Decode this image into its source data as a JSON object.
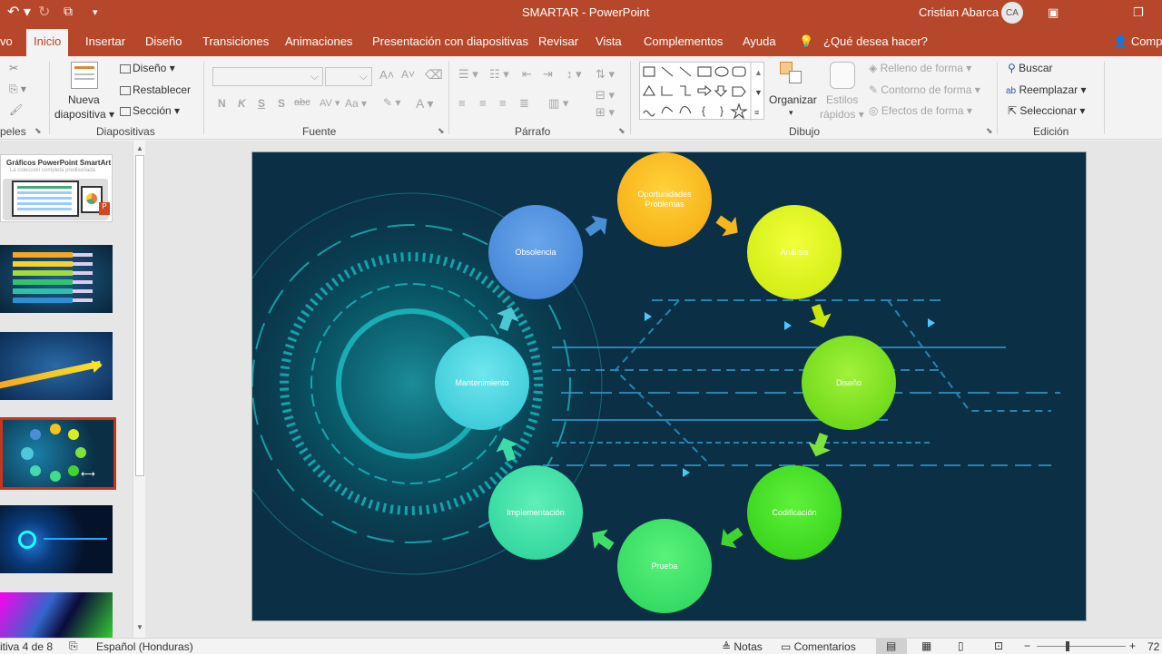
{
  "titlebar": {
    "doc": "SMARTAR",
    "sep": " - ",
    "app": "PowerPoint",
    "user": "Cristian Abarca",
    "initials": "CA"
  },
  "tabs": [
    "vo",
    "Inicio",
    "Insertar",
    "Diseño",
    "Transiciones",
    "Animaciones",
    "Presentación con diapositivas",
    "Revisar",
    "Vista",
    "Complementos",
    "Ayuda"
  ],
  "tellme": "¿Qué desea hacer?",
  "share": "Compa",
  "ribbon": {
    "portapapeles": "peles",
    "nueva1": "Nueva",
    "nueva2": "diapositiva",
    "layout": "Diseño",
    "reset": "Restablecer",
    "section": "Sección",
    "g_slides": "Diapositivas",
    "fontrow": [
      "N",
      "K",
      "S",
      "S",
      "abc",
      "AV",
      "Aa"
    ],
    "g_font": "Fuente",
    "g_para": "Párrafo",
    "organize": "Organizar",
    "styles1": "Estilos",
    "styles2": "rápidos",
    "fill": "Relleno de forma",
    "outline": "Contorno de forma",
    "effects": "Efectos de forma",
    "g_draw": "Dibujo",
    "find": "Buscar",
    "replace": "Reemplazar",
    "select": "Seleccionar",
    "g_edit": "Edición"
  },
  "thumb1": {
    "title": "Gráficos PowerPoint SmartArt",
    "subtitle": "La colección completa prediseñada"
  },
  "diagram": {
    "nodes": [
      "Oportunidades\nProblemas",
      "Análisis",
      "Diseño",
      "Codificación",
      "Prueba",
      "Implementación",
      "Mantenimiento",
      "Obsolencia"
    ]
  },
  "status": {
    "slide": "itiva 4 de 8",
    "lang": "Español (Honduras)",
    "notes": "Notas",
    "comments": "Comentarios",
    "zoom": "72"
  },
  "colors": {
    "accent": "#b7472a",
    "slidebg": "#0b2f45"
  }
}
